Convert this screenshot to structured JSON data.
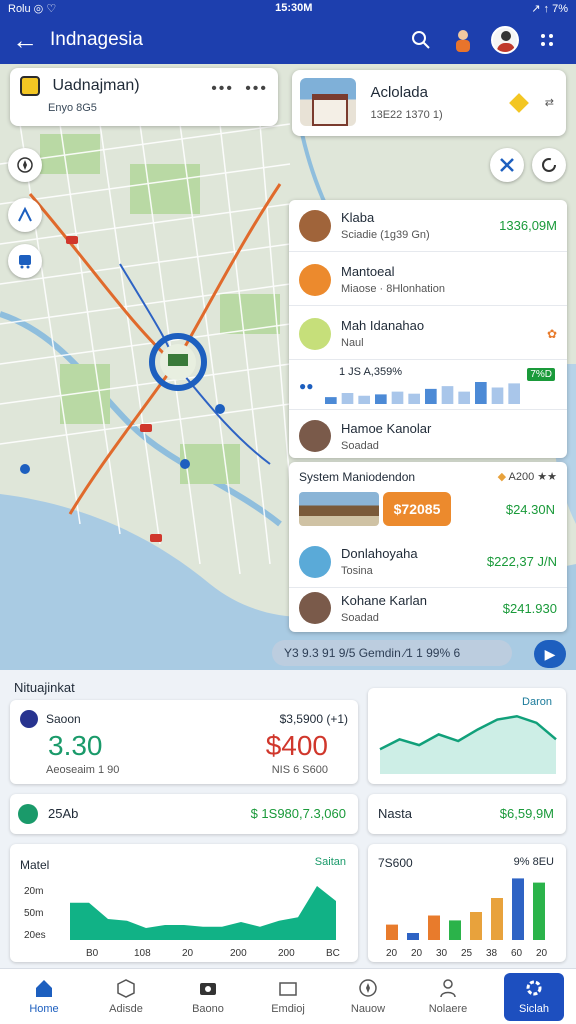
{
  "status_bar": {
    "left": "Rolu ◎ ♡",
    "center": "15:30M",
    "right": "↗ ↑ 7%"
  },
  "app_bar": {
    "title": "Indnagesia"
  },
  "location_card": {
    "name": "Uadnajman)",
    "sub": "Enyo 8G5"
  },
  "header_card": {
    "title": "Aclolada",
    "sub": "13E22 1370 1)"
  },
  "list": [
    {
      "title": "Klaba",
      "sub": "Sciadie (1g39 Gn)",
      "value": "1336,09M",
      "accent": "#a0643a"
    },
    {
      "title": "Mantoeal",
      "sub": "Miaose · 8Hlonhation",
      "value": "",
      "accent": "#ec8a2d"
    },
    {
      "title": "Mah Idanahao",
      "sub": "Naul",
      "value": "",
      "accent": "#c6df7a"
    },
    {
      "title": "Hamoe Kanolar",
      "sub": "Soadad",
      "value": "",
      "accent": "#7a5a4a"
    }
  ],
  "mini_chart": {
    "label": "1 JS A,359%",
    "tag": "7%D",
    "values": [
      1,
      1.6,
      1.2,
      1.4,
      1.8,
      1.5,
      2.2,
      2.6,
      1.8,
      3.2,
      2.4,
      3.0
    ]
  },
  "system_card": {
    "header": "System Maniodendon",
    "rating": "A200",
    "pill": "$72085",
    "pill_value": "$24.30N",
    "rows": [
      {
        "title": "Donlahoyaha",
        "sub": "Tosina",
        "value": "$222,37 J/N",
        "accent": "#5aaad8"
      },
      {
        "title": "Kohane Karlan",
        "sub": "Soadad",
        "value": "$241.930",
        "accent": "#7a5a4a"
      }
    ]
  },
  "search_bar": {
    "text": "Y3 9.3 91 9/5 Gemdin ∕1 1 99% 6"
  },
  "dashboard": {
    "title": "Nituajinkat",
    "stat": {
      "label": "Saoon",
      "value_left": "3.30",
      "sub_left": "Aeoseaim 1 90",
      "label_right": "$3,5900 (+1)",
      "value_right": "$400",
      "sub_right": "NIS 6 S600"
    },
    "line_panel": {
      "label": "Daron",
      "values": [
        3,
        4.2,
        3.5,
        4.8,
        4.0,
        5.4,
        6.6,
        7.0,
        6.2,
        4.2
      ]
    },
    "strip": {
      "label": "25Ab",
      "value": "$ 1S980,7.3,060"
    },
    "strip2": {
      "label": "Nasta",
      "value": "$6,59,9M"
    },
    "area_panel": {
      "label": "Matel",
      "right": "Saitan",
      "yticks": [
        "20m",
        "50m",
        "20es"
      ],
      "xticks": [
        "B0",
        "108",
        "20",
        "200",
        "200",
        "BC"
      ],
      "values": [
        0.62,
        0.62,
        0.35,
        0.32,
        0.2,
        0.25,
        0.25,
        0.22,
        0.22,
        0.3,
        0.22,
        0.32,
        0.38,
        0.9,
        0.65
      ]
    },
    "bar_panel": {
      "label": "7S600",
      "right": "9% 8EU",
      "xticks": [
        "20",
        "20",
        "30",
        "25",
        "38",
        "60",
        "20"
      ],
      "bars": [
        {
          "value": 0.22,
          "color": "#e87b2c"
        },
        {
          "value": 0.1,
          "color": "#2e63c4"
        },
        {
          "value": 0.35,
          "color": "#e87b2c"
        },
        {
          "value": 0.28,
          "color": "#2bb34a"
        },
        {
          "value": 0.4,
          "color": "#e8a23c"
        },
        {
          "value": 0.6,
          "color": "#e8a23c"
        },
        {
          "value": 0.88,
          "color": "#2e63c4"
        },
        {
          "value": 0.82,
          "color": "#2bb34a"
        }
      ]
    }
  },
  "nav": [
    {
      "label": "Home",
      "icon": "home-icon"
    },
    {
      "label": "Adisde",
      "icon": "box-icon"
    },
    {
      "label": "Baono",
      "icon": "camera-icon"
    },
    {
      "label": "Emdioj",
      "icon": "folder-icon"
    },
    {
      "label": "Nauow",
      "icon": "compass-icon"
    },
    {
      "label": "Nolaere",
      "icon": "user-icon"
    },
    {
      "label": "Siclah",
      "icon": "settings-icon"
    }
  ],
  "colors": {
    "primary": "#1d3fae",
    "accent_green": "#1a9a3a",
    "accent_red": "#d0372c",
    "chart_teal": "#11b286"
  }
}
